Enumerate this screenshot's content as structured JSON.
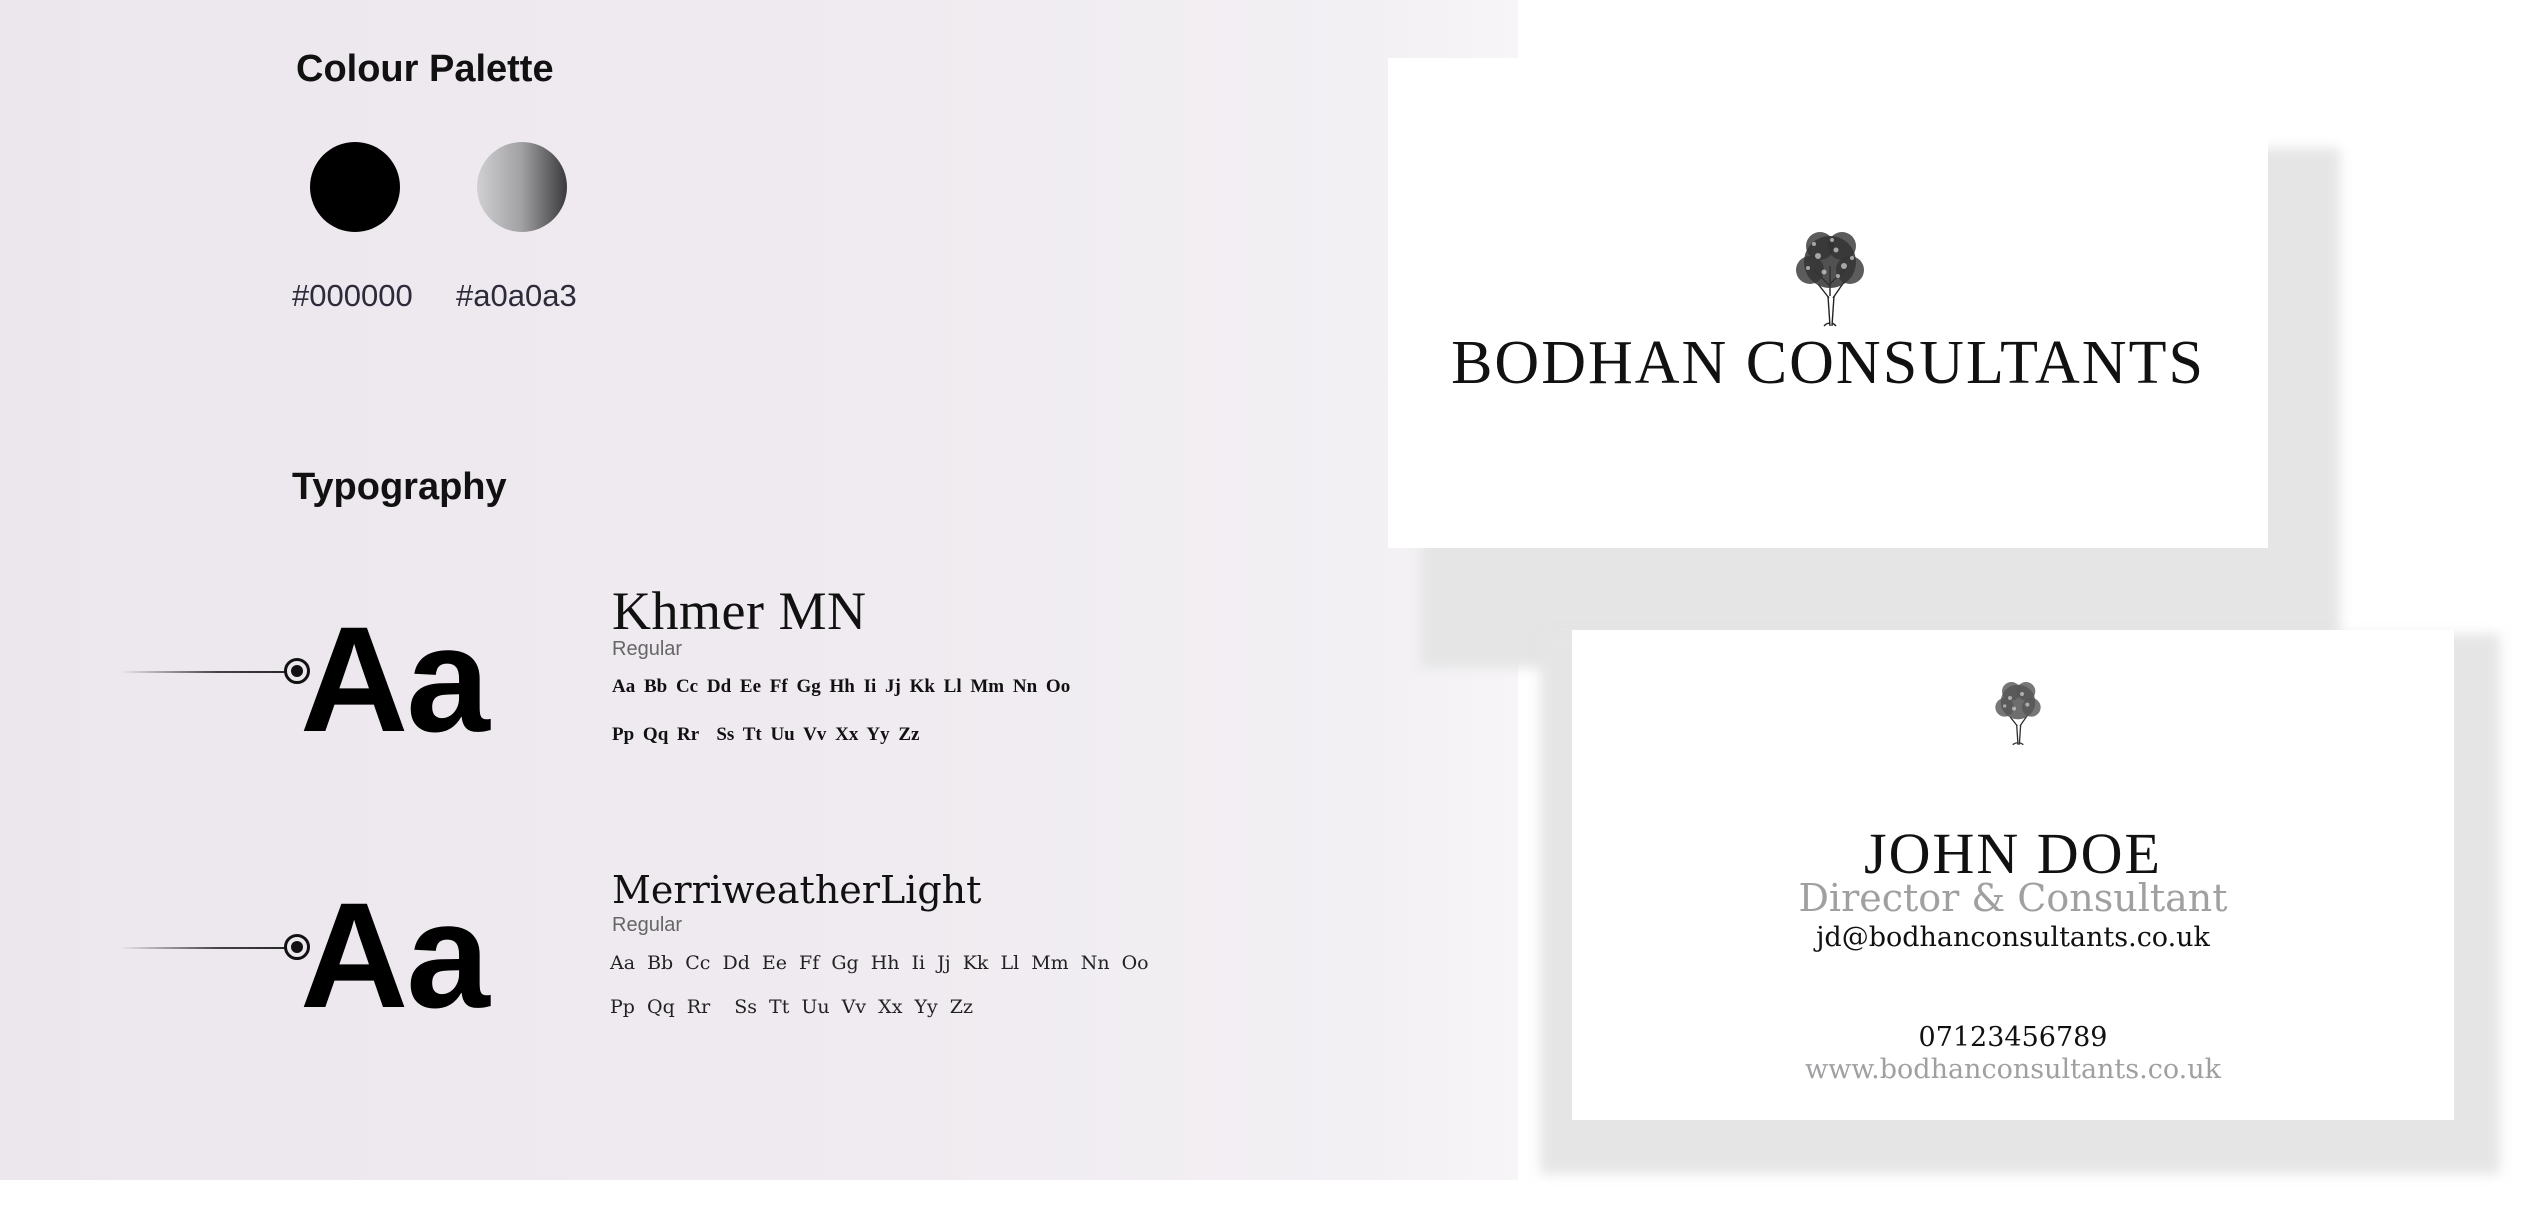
{
  "palette": {
    "title": "Colour Palette",
    "colors": [
      {
        "hex_label": "#000000",
        "fill": "#000000"
      },
      {
        "hex_label": "#a0a0a3",
        "fill_gradient": [
          "#d0d0d2",
          "#a0a0a3",
          "#3a3a3c"
        ]
      }
    ]
  },
  "typography": {
    "title": "Typography",
    "sample": "Aa",
    "fonts": [
      {
        "name": "Khmer MN",
        "style": "Regular",
        "glyph_row_1": "Aa Bb Cc Dd Ee Ff Gg Hh Ii Jj Kk Ll Mm Nn Oo",
        "glyph_row_2": "Pp Qq Rr  Ss Tt Uu Vv Xx Yy Zz"
      },
      {
        "name": "MerriweatherLight",
        "style": "Regular",
        "glyph_row_1": "Aa Bb Cc Dd Ee Ff Gg Hh Ii Jj Kk Ll Mm Nn Oo",
        "glyph_row_2": "Pp Qq Rr  Ss Tt Uu Vv Xx Yy Zz"
      }
    ]
  },
  "cards": {
    "front": {
      "logo_icon": "tree-icon",
      "company": "BODHAN CONSULTANTS"
    },
    "back": {
      "logo_icon": "tree-icon",
      "name": "JOHN DOE",
      "role": "Director & Consultant",
      "email": "jd@bodhanconsultants.co.uk",
      "phone": "07123456789",
      "website": "www.bodhanconsultants.co.uk"
    }
  }
}
